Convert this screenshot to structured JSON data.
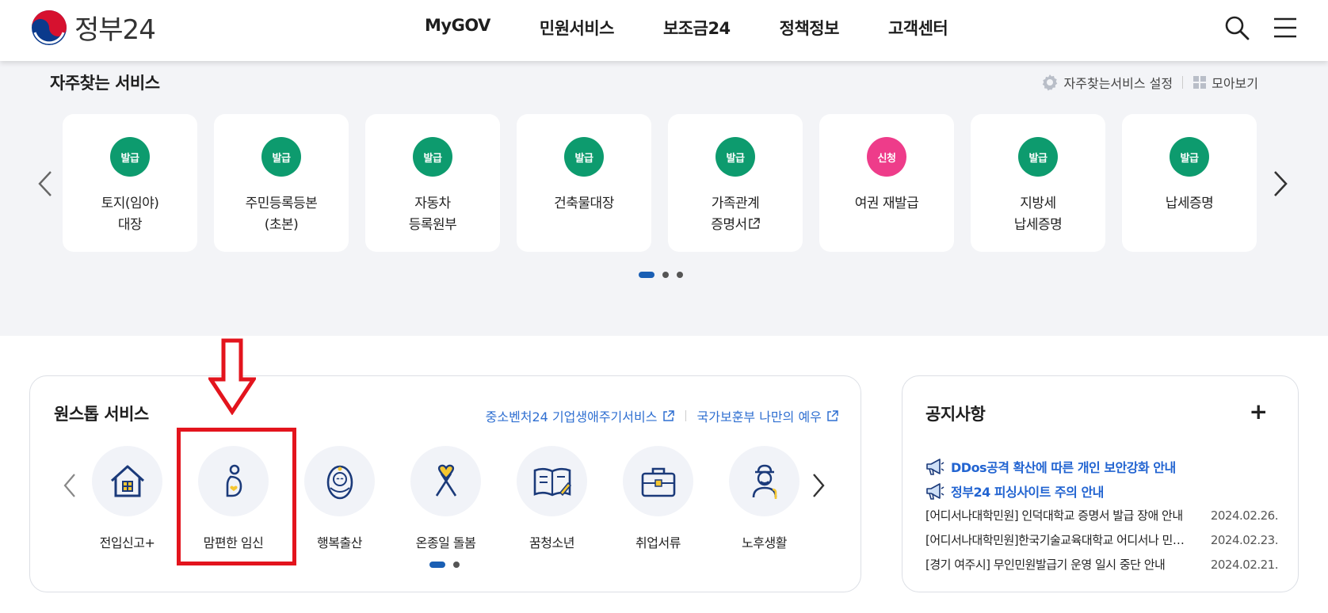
{
  "header": {
    "logo_text": "정부24",
    "nav": [
      "MyGOV",
      "민원서비스",
      "보조금24",
      "정책정보",
      "고객센터"
    ]
  },
  "frequent": {
    "title": "자주찾는 서비스",
    "settings_label": "자주찾는서비스 설정",
    "view_all_label": "모아보기",
    "cards": [
      {
        "badge": "발급",
        "badge_color": "#0d9b6e",
        "line1": "토지(임야)",
        "line2": "대장",
        "external": false
      },
      {
        "badge": "발급",
        "badge_color": "#0d9b6e",
        "line1": "주민등록등본",
        "line2": "(초본)",
        "external": false
      },
      {
        "badge": "발급",
        "badge_color": "#0d9b6e",
        "line1": "자동차",
        "line2": "등록원부",
        "external": false
      },
      {
        "badge": "발급",
        "badge_color": "#0d9b6e",
        "line1": "건축물대장",
        "line2": "",
        "external": false
      },
      {
        "badge": "발급",
        "badge_color": "#0d9b6e",
        "line1": "가족관계",
        "line2": "증명서",
        "external": true
      },
      {
        "badge": "신청",
        "badge_color": "#ee3c8a",
        "line1": "여권 재발급",
        "line2": "",
        "external": false
      },
      {
        "badge": "발급",
        "badge_color": "#0d9b6e",
        "line1": "지방세",
        "line2": "납세증명",
        "external": false
      },
      {
        "badge": "발급",
        "badge_color": "#0d9b6e",
        "line1": "납세증명",
        "line2": "",
        "external": false
      }
    ],
    "page_count": 3,
    "current_page": 1
  },
  "onestop": {
    "title": "원스톱 서비스",
    "link1": "중소벤처24 기업생애주기서비스",
    "link2": "국가보훈부 나만의 예우",
    "items": [
      {
        "label": "전입신고+",
        "icon": "house-icon"
      },
      {
        "label": "맘편한 임신",
        "icon": "pregnancy-icon"
      },
      {
        "label": "행복출산",
        "icon": "baby-icon"
      },
      {
        "label": "온종일 돌봄",
        "icon": "ribbon-heart-icon"
      },
      {
        "label": "꿈청소년",
        "icon": "open-book-icon"
      },
      {
        "label": "취업서류",
        "icon": "briefcase-icon"
      },
      {
        "label": "노후생활",
        "icon": "elderly-icon"
      }
    ],
    "page_count": 2,
    "current_page": 1,
    "highlighted_item": "맘편한 임신"
  },
  "notice": {
    "title": "공지사항",
    "more_label": "+",
    "highlights": [
      "DDos공격 확산에 따른 개인 보안강화 안내",
      "정부24 피싱사이트 주의 안내"
    ],
    "rows": [
      {
        "text": "[어디서나대학민원] 인덕대학교 증명서 발급 장애 안내",
        "date": "2024.02.26."
      },
      {
        "text": "[어디서나대학민원]한국기술교육대학교 어디서나 민원 서비스 중단 안내",
        "date": "2024.02.23."
      },
      {
        "text": "[경기 여주시] 무인민원발급기 운영 일시 중단 안내",
        "date": "2024.02.21."
      }
    ]
  },
  "colors": {
    "accent_blue": "#1a5fb4",
    "badge_green": "#0d9b6e",
    "badge_pink": "#ee3c8a",
    "annotation_red": "#e3141d",
    "icon_navy": "#1b3a7a"
  }
}
